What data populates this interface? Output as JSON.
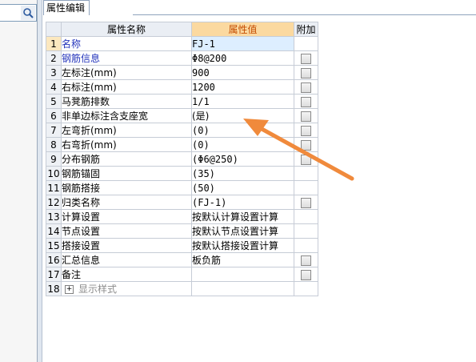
{
  "tab": {
    "label": "属性编辑"
  },
  "grid": {
    "headers": {
      "name": "属性名称",
      "value": "属性值",
      "addon": "附加"
    },
    "rows": [
      {
        "num": "1",
        "name": "名称",
        "value": "FJ-1",
        "checkbox": false,
        "style": "blue"
      },
      {
        "num": "2",
        "name": "钢筋信息",
        "value": "Φ8@200",
        "checkbox": true,
        "style": "blue"
      },
      {
        "num": "3",
        "name": "左标注(mm)",
        "value": "900",
        "checkbox": true,
        "style": ""
      },
      {
        "num": "4",
        "name": "右标注(mm)",
        "value": "1200",
        "checkbox": true,
        "style": ""
      },
      {
        "num": "5",
        "name": "马凳筋排数",
        "value": "1/1",
        "checkbox": true,
        "style": ""
      },
      {
        "num": "6",
        "name": "非单边标注含支座宽",
        "value": "(是)",
        "checkbox": true,
        "style": ""
      },
      {
        "num": "7",
        "name": "左弯折(mm)",
        "value": "(0)",
        "checkbox": true,
        "style": ""
      },
      {
        "num": "8",
        "name": "右弯折(mm)",
        "value": "(0)",
        "checkbox": true,
        "style": ""
      },
      {
        "num": "9",
        "name": "分布钢筋",
        "value": "(Φ6@250)",
        "checkbox": true,
        "style": ""
      },
      {
        "num": "10",
        "name": "钢筋锚固",
        "value": "(35)",
        "checkbox": false,
        "style": ""
      },
      {
        "num": "11",
        "name": "钢筋搭接",
        "value": "(50)",
        "checkbox": false,
        "style": ""
      },
      {
        "num": "12",
        "name": "归类名称",
        "value": "(FJ-1)",
        "checkbox": true,
        "style": ""
      },
      {
        "num": "13",
        "name": "计算设置",
        "value": "按默认计算设置计算",
        "checkbox": false,
        "style": ""
      },
      {
        "num": "14",
        "name": "节点设置",
        "value": "按默认节点设置计算",
        "checkbox": false,
        "style": ""
      },
      {
        "num": "15",
        "name": "搭接设置",
        "value": "按默认搭接设置计算",
        "checkbox": false,
        "style": ""
      },
      {
        "num": "16",
        "name": "汇总信息",
        "value": "板负筋",
        "checkbox": true,
        "style": ""
      },
      {
        "num": "17",
        "name": "备注",
        "value": "",
        "checkbox": true,
        "style": ""
      },
      {
        "num": "18",
        "name": "显示样式",
        "value": "",
        "checkbox": false,
        "style": "gray",
        "expandable": true
      }
    ]
  },
  "colors": {
    "accent_arrow": "#f08a3c",
    "header_value_bg": "#fbd9a0",
    "header_value_text": "#c44b00",
    "blue_label": "#2233bb"
  },
  "icons": {
    "search": "search-icon",
    "expand": "expand-plus-icon",
    "annotation": "annotation-arrow"
  }
}
